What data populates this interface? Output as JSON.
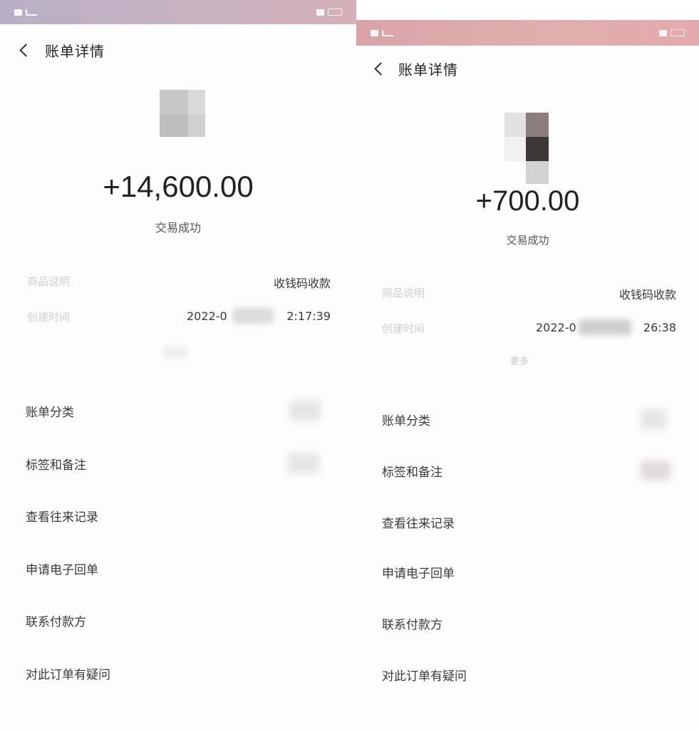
{
  "left": {
    "nav_title": "账单详情",
    "amount": "+14,600.00",
    "status": "交易成功",
    "info": [
      {
        "label": "商品说明",
        "value": "收钱码收款"
      },
      {
        "label": "创建时间",
        "value_start": "2022-0",
        "value_end": "2:17:39"
      }
    ],
    "menu": [
      {
        "label": "账单分类"
      },
      {
        "label": "标签和备注"
      },
      {
        "label": "查看往来记录"
      },
      {
        "label": "申请电子回单"
      },
      {
        "label": "联系付款方"
      },
      {
        "label": "对此订单有疑问"
      }
    ]
  },
  "right": {
    "nav_title": "账单详情",
    "amount": "+700.00",
    "status": "交易成功",
    "info": [
      {
        "label": "商品说明",
        "value": "收钱码收款"
      },
      {
        "label": "创建时间",
        "value_start": "2022-0",
        "value_end": "26:38"
      }
    ],
    "more": "更多",
    "menu": [
      {
        "label": "账单分类"
      },
      {
        "label": "标签和备注"
      },
      {
        "label": "查看往来记录"
      },
      {
        "label": "申请电子回单"
      },
      {
        "label": "联系付款方"
      },
      {
        "label": "对此订单有疑问"
      }
    ]
  },
  "colors": {
    "left_statusbar": "#c4b2c4",
    "right_statusbar": "#df aaad",
    "amount_text": "#222222",
    "label_faded": "#cfcfcf"
  },
  "icons": [
    "back-arrow-icon",
    "signal-icon",
    "battery-icon"
  ]
}
